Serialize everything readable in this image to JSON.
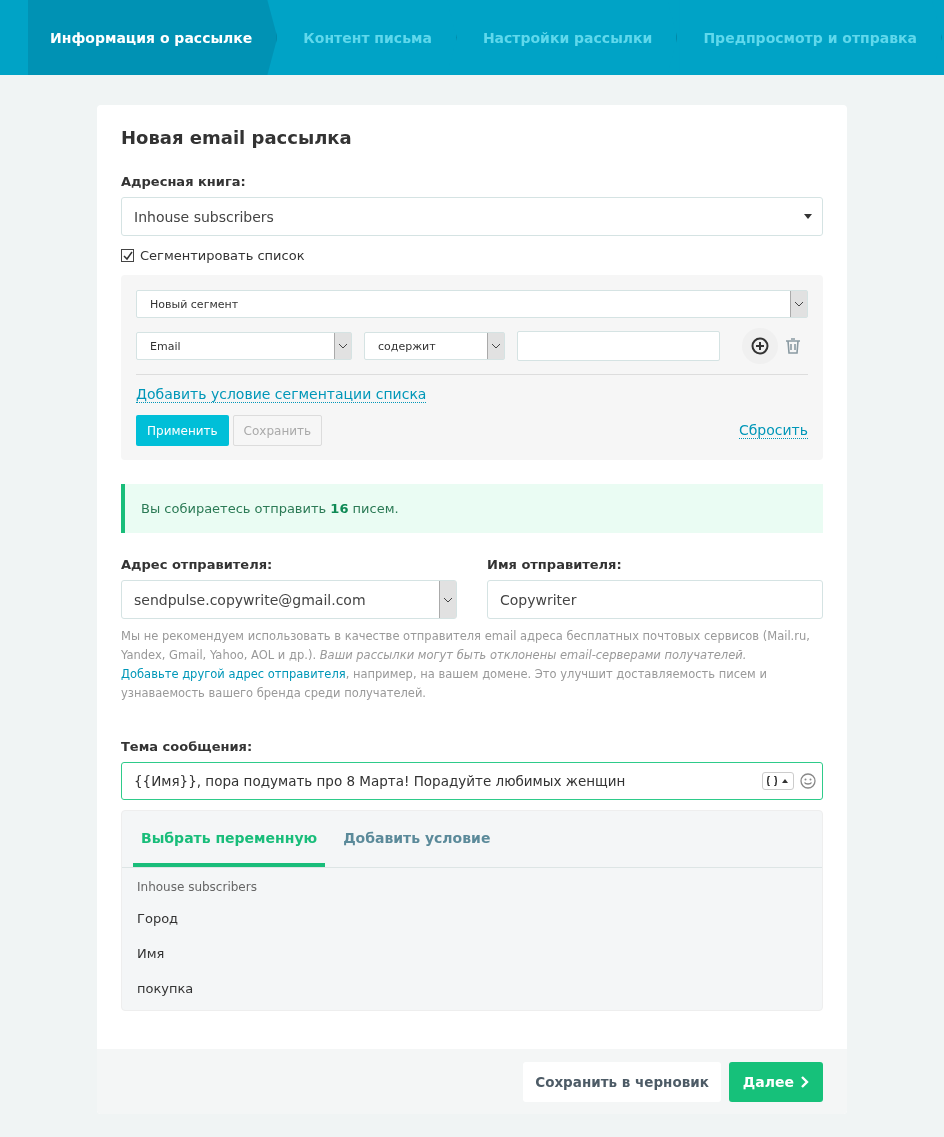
{
  "steps": [
    {
      "label": "Информация о рассылке",
      "selected": true
    },
    {
      "label": "Контент письма",
      "selected": false
    },
    {
      "label": "Настройки рассылки",
      "selected": false
    },
    {
      "label": "Предпросмотр и отправка",
      "selected": false
    }
  ],
  "card": {
    "title": "Новая email рассылка",
    "address_book": {
      "label": "Адресная книга:",
      "value": "Inhouse subscribers"
    },
    "segment": {
      "label": "Сегментировать список",
      "checked": true,
      "segment_select": "Новый сегмент",
      "field_select": "Email",
      "operator_select": "содержит",
      "add_condition_link": "Добавить условие сегментации списка",
      "apply_button": "Применить",
      "save_button": "Сохранить",
      "reset_link": "Сбросить"
    },
    "alert": "Вы собираетесь отправить **16** писем.",
    "sender_address": {
      "label": "Адрес отправителя:",
      "value": "sendpulse.copywrite@gmail.com"
    },
    "sender_name": {
      "label": "Имя отправителя:",
      "value": "Copywriter"
    },
    "notice_before": "Мы не рекомендуем использовать в качестве отправителя email адреса бесплатных почтовых сервисов (Mail.ru, Yandex, Gmail, Yahoo, AOL и др.). *Ваши рассылки могут быть отклонены email-серверами получателей.* ",
    "notice_link": "Добавьте другой адрес отправителя",
    "notice_after": ", например, на вашем домене. Это улучшит доставляемость писем и узнаваемость вашего бренда среди получателей.",
    "subject": {
      "label": "Тема сообщения:",
      "value": "{{Имя}}, пора подумать про 8 Марта! Порадуйте любимых женщин"
    },
    "variable_tabs": [
      {
        "label": "Выбрать переменную",
        "selected": true
      },
      {
        "label": "Добавить условие",
        "selected": false
      }
    ],
    "variable_group": "Inhouse subscribers",
    "variables": [
      "Город",
      "Имя",
      "покупка"
    ]
  },
  "footer": {
    "draft_button": "Сохранить в черновик",
    "next_button": "Далее"
  }
}
